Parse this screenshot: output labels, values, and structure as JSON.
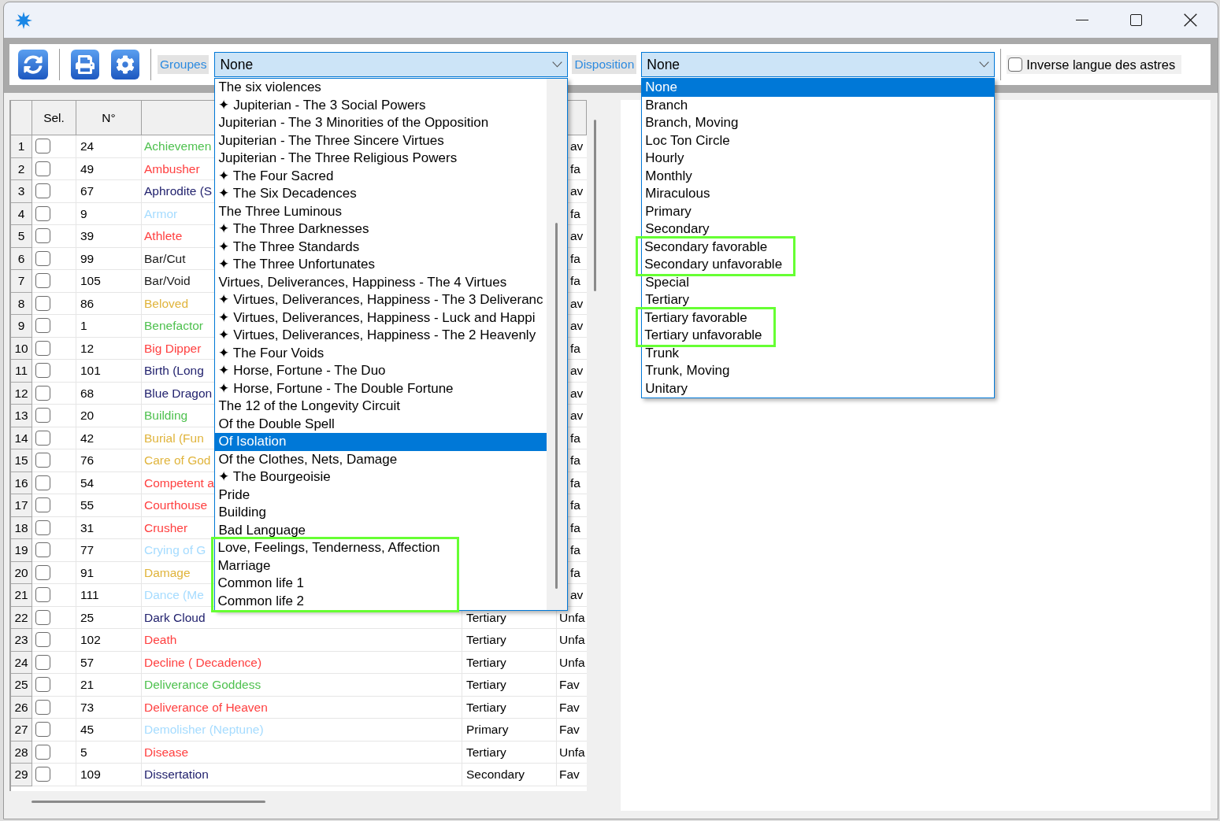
{
  "toolbar": {
    "button_groups": [
      [
        {
          "kind": "refresh"
        }
      ],
      [
        {
          "kind": "print"
        },
        {
          "kind": "settings"
        }
      ]
    ],
    "dropdowns": [
      {
        "label": "Groupes",
        "value": "None",
        "expanded": true,
        "options": [
          {
            "label": "The six violences",
            "selected": false,
            "highlighted": false
          },
          {
            "label": "✦ Jupiterian - The 3 Social Powers",
            "selected": false,
            "highlighted": false
          },
          {
            "label": "Jupiterian - The 3 Minorities of the Opposition",
            "selected": false,
            "highlighted": false
          },
          {
            "label": "Jupiterian - The Three Sincere Virtues",
            "selected": false,
            "highlighted": false
          },
          {
            "label": "Jupiterian - The Three Religious Powers",
            "selected": false,
            "highlighted": false
          },
          {
            "label": "✦ The Four Sacred",
            "selected": false,
            "highlighted": false
          },
          {
            "label": "✦ The Six Decadences",
            "selected": false,
            "highlighted": false
          },
          {
            "label": "The Three Luminous",
            "selected": false,
            "highlighted": false
          },
          {
            "label": "✦ The Three Darknesses",
            "selected": false,
            "highlighted": false
          },
          {
            "label": "✦ The Three Standards",
            "selected": false,
            "highlighted": false
          },
          {
            "label": "✦ The Three Unfortunates",
            "selected": false,
            "highlighted": false
          },
          {
            "label": "Virtues, Deliverances, Happiness - The 4 Virtues",
            "selected": false,
            "highlighted": false
          },
          {
            "label": "✦ Virtues, Deliverances, Happiness - The 3 Deliveranc",
            "selected": false,
            "highlighted": false
          },
          {
            "label": "✦ Virtues, Deliverances, Happiness - Luck and Happi",
            "selected": false,
            "highlighted": false
          },
          {
            "label": "✦ Virtues, Deliverances, Happiness - The 2 Heavenly",
            "selected": false,
            "highlighted": false
          },
          {
            "label": "✦ The Four Voids",
            "selected": false,
            "highlighted": false
          },
          {
            "label": "✦ Horse, Fortune - The Duo",
            "selected": false,
            "highlighted": false
          },
          {
            "label": "✦ Horse, Fortune - The Double Fortune",
            "selected": false,
            "highlighted": false
          },
          {
            "label": "The 12 of the Longevity Circuit",
            "selected": false,
            "highlighted": false
          },
          {
            "label": "Of the Double Spell",
            "selected": false,
            "highlighted": false
          },
          {
            "label": "Of Isolation",
            "selected": true,
            "highlighted": false
          },
          {
            "label": "Of the Clothes, Nets, Damage",
            "selected": false,
            "highlighted": false
          },
          {
            "label": "✦ The Bourgeoisie",
            "selected": false,
            "highlighted": false
          },
          {
            "label": "Pride",
            "selected": false,
            "highlighted": false
          },
          {
            "label": "Building",
            "selected": false,
            "highlighted": false
          },
          {
            "label": "Bad Language",
            "selected": false,
            "highlighted": false
          },
          {
            "label": "Love, Feelings, Tenderness, Affection",
            "selected": false,
            "highlighted": true
          },
          {
            "label": "Marriage",
            "selected": false,
            "highlighted": true
          },
          {
            "label": "Common life 1",
            "selected": false,
            "highlighted": true
          },
          {
            "label": "Common life 2",
            "selected": false,
            "highlighted": true
          }
        ]
      },
      {
        "label": "Disposition",
        "value": "None",
        "expanded": true,
        "options": [
          {
            "label": "None",
            "selected": true,
            "highlighted": false
          },
          {
            "label": "Branch",
            "selected": false,
            "highlighted": false
          },
          {
            "label": "Branch, Moving",
            "selected": false,
            "highlighted": false
          },
          {
            "label": "Loc Ton Circle",
            "selected": false,
            "highlighted": false
          },
          {
            "label": "Hourly",
            "selected": false,
            "highlighted": false
          },
          {
            "label": "Monthly",
            "selected": false,
            "highlighted": false
          },
          {
            "label": "Miraculous",
            "selected": false,
            "highlighted": false
          },
          {
            "label": "Primary",
            "selected": false,
            "highlighted": false
          },
          {
            "label": "Secondary",
            "selected": false,
            "highlighted": false
          },
          {
            "label": "Secondary favorable",
            "selected": false,
            "highlighted": true
          },
          {
            "label": "Secondary unfavorable",
            "selected": false,
            "highlighted": true
          },
          {
            "label": "Special",
            "selected": false,
            "highlighted": false
          },
          {
            "label": "Tertiary",
            "selected": false,
            "highlighted": false
          },
          {
            "label": "Tertiary favorable",
            "selected": false,
            "highlighted": true
          },
          {
            "label": "Tertiary unfavorable",
            "selected": false,
            "highlighted": true
          },
          {
            "label": "Trunk",
            "selected": false,
            "highlighted": false
          },
          {
            "label": "Trunk, Moving",
            "selected": false,
            "highlighted": false
          },
          {
            "label": "Unitary",
            "selected": false,
            "highlighted": false
          }
        ]
      }
    ],
    "option_checkbox": {
      "label": "Inverse langue des astres",
      "checked": false
    }
  },
  "table": {
    "columns": [
      {
        "label": "Sel."
      },
      {
        "label": "N°"
      }
    ],
    "rows": [
      {
        "number": "1",
        "checked": false,
        "n": "24",
        "name": "Achievemen",
        "color": "#4fc14f",
        "column_6": "av"
      },
      {
        "number": "2",
        "checked": false,
        "n": "49",
        "name": "Ambusher",
        "color": "#ff4040",
        "column_6": "fa"
      },
      {
        "number": "3",
        "checked": false,
        "n": "67",
        "name": "Aphrodite (S",
        "color": "#22226e",
        "column_6": "av"
      },
      {
        "number": "4",
        "checked": false,
        "n": "9",
        "name": "Armor",
        "color": "#a6dcff",
        "column_6": "fa"
      },
      {
        "number": "5",
        "checked": false,
        "n": "39",
        "name": "Athlete",
        "color": "#ff4040",
        "column_6": "av"
      },
      {
        "number": "6",
        "checked": false,
        "n": "99",
        "name": "Bar/Cut",
        "color": "#1a1a1a",
        "column_6": "fa"
      },
      {
        "number": "7",
        "checked": false,
        "n": "105",
        "name": "Bar/Void",
        "color": "#1a1a1a",
        "column_6": "fa"
      },
      {
        "number": "8",
        "checked": false,
        "n": "86",
        "name": "Beloved",
        "color": "#e0b43c",
        "column_6": "av"
      },
      {
        "number": "9",
        "checked": false,
        "n": "1",
        "name": "Benefactor",
        "color": "#4fc14f",
        "column_6": "av"
      },
      {
        "number": "10",
        "checked": false,
        "n": "12",
        "name": "Big Dipper",
        "color": "#ff4040",
        "column_6": "fa"
      },
      {
        "number": "11",
        "checked": false,
        "n": "101",
        "name": "Birth (Long",
        "color": "#22226e",
        "column_6": "av"
      },
      {
        "number": "12",
        "checked": false,
        "n": "68",
        "name": "Blue Dragon",
        "color": "#22226e",
        "column_6": "av"
      },
      {
        "number": "13",
        "checked": false,
        "n": "20",
        "name": "Building",
        "color": "#4fc14f",
        "column_6": "av"
      },
      {
        "number": "14",
        "checked": false,
        "n": "42",
        "name": "Burial (Fun",
        "color": "#e0b43c",
        "column_6": "fa"
      },
      {
        "number": "15",
        "checked": false,
        "n": "76",
        "name": "Care of God",
        "color": "#e0b43c",
        "column_6": "fa"
      },
      {
        "number": "16",
        "checked": false,
        "n": "54",
        "name": "Competent a",
        "color": "#ff4040",
        "column_6": "fa"
      },
      {
        "number": "17",
        "checked": false,
        "n": "55",
        "name": "Courthouse",
        "color": "#ff4040",
        "column_6": "fa"
      },
      {
        "number": "18",
        "checked": false,
        "n": "31",
        "name": "Crusher",
        "color": "#ff4040",
        "column_6": "fa"
      },
      {
        "number": "19",
        "checked": false,
        "n": "77",
        "name": "Crying of G",
        "color": "#a6dcff",
        "column_6": "fa"
      },
      {
        "number": "20",
        "checked": false,
        "n": "91",
        "name": "Damage",
        "color": "#e0b43c",
        "column_6": "fa"
      },
      {
        "number": "21",
        "checked": false,
        "n": "111",
        "name": "Dance (Me",
        "color": "#a6dcff",
        "column_6": "av"
      },
      {
        "number": "22",
        "checked": false,
        "n": "25",
        "name": "Dark Cloud",
        "color": "#22226e",
        "column_5": "Tertiary",
        "column_6": "Unfa"
      },
      {
        "number": "23",
        "checked": false,
        "n": "102",
        "name": "Death",
        "color": "#ff4040",
        "column_5": "Tertiary",
        "column_6": "Unfa"
      },
      {
        "number": "24",
        "checked": false,
        "n": "57",
        "name": "Decline ( Decadence)",
        "color": "#ff4040",
        "column_5": "Tertiary",
        "column_6": "Unfa"
      },
      {
        "number": "25",
        "checked": false,
        "n": "21",
        "name": "Deliverance Goddess",
        "color": "#4fc14f",
        "column_5": "Tertiary",
        "column_6": "Fav"
      },
      {
        "number": "26",
        "checked": false,
        "n": "73",
        "name": "Deliverance of Heaven",
        "color": "#ff4040",
        "column_5": "Tertiary",
        "column_6": "Fav"
      },
      {
        "number": "27",
        "checked": false,
        "n": "45",
        "name": "Demolisher (Neptune)",
        "color": "#a6dcff",
        "column_5": "Primary",
        "column_6": "Fav"
      },
      {
        "number": "28",
        "checked": false,
        "n": "5",
        "name": "Disease",
        "color": "#ff4040",
        "column_5": "Tertiary",
        "column_6": "Unfa"
      },
      {
        "number": "29",
        "checked": false,
        "n": "109",
        "name": "Dissertation",
        "color": "#22226e",
        "column_5": "Secondary",
        "column_6": "Fav"
      }
    ]
  }
}
